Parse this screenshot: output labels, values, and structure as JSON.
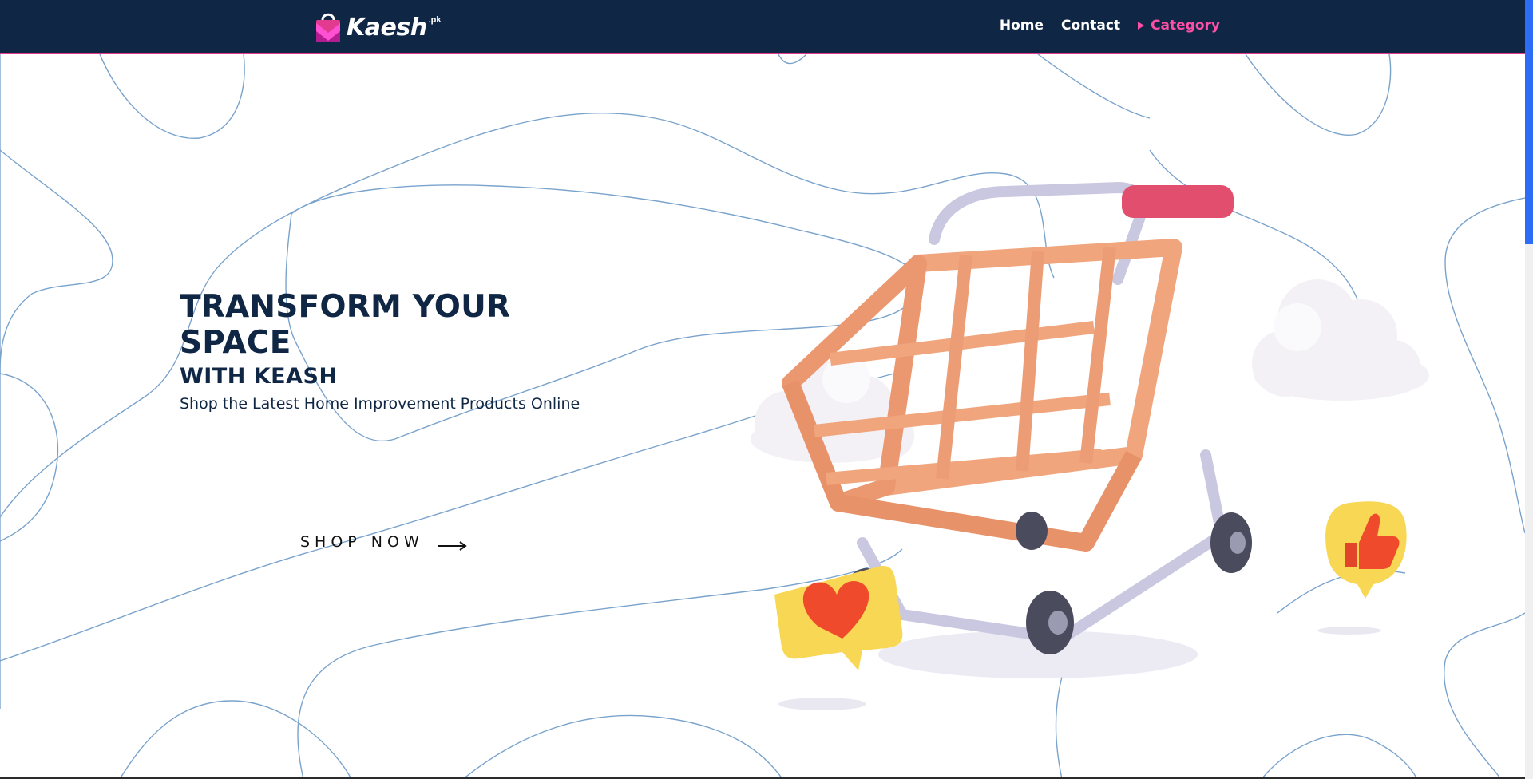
{
  "brand": {
    "name": "Kaesh",
    "tld": ".pk",
    "colors": {
      "navy": "#0f2745",
      "pink": "#e23a8f",
      "accent": "#ff4fa6"
    }
  },
  "nav": {
    "items": [
      {
        "label": "Home"
      },
      {
        "label": "Contact"
      },
      {
        "label": "Category",
        "active": true
      }
    ]
  },
  "hero": {
    "title": "TRANSFORM YOUR SPACE",
    "subtitle": "WITH KEASH",
    "tagline": "Shop the Latest Home Improvement Products Online",
    "cta_label": "SHOP NOW"
  },
  "illustration": {
    "icons": [
      "shopping-cart-icon",
      "heart-icon",
      "thumbs-up-icon",
      "cloud-icon"
    ]
  }
}
